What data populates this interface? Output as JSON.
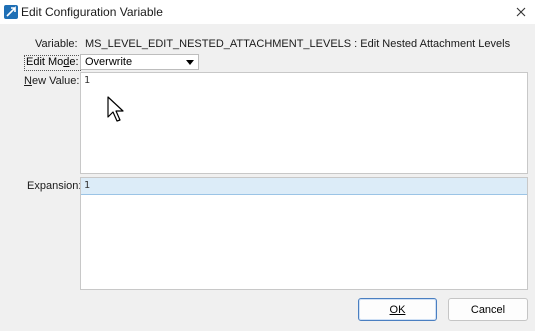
{
  "window": {
    "title": "Edit Configuration Variable",
    "icon": "app-icon",
    "close_icon": "close-icon"
  },
  "form": {
    "variable_label": "Variable:",
    "variable_value": "MS_LEVEL_EDIT_NESTED_ATTACHMENT_LEVELS : Edit Nested Attachment Levels",
    "edit_mode_label_pre": "Edit Mo",
    "edit_mode_label_accel": "d",
    "edit_mode_label_post": "e:",
    "edit_mode_value": "Overwrite",
    "new_value_label_accel": "N",
    "new_value_label_post": "ew Value:",
    "new_value_text": "1",
    "expansion_label": "Expansion:",
    "expansion_text": "1"
  },
  "buttons": {
    "ok_label": "OK",
    "cancel_label": "Cancel"
  },
  "colors": {
    "accent": "#4a7fc1",
    "highlight": "#dcecf8"
  }
}
